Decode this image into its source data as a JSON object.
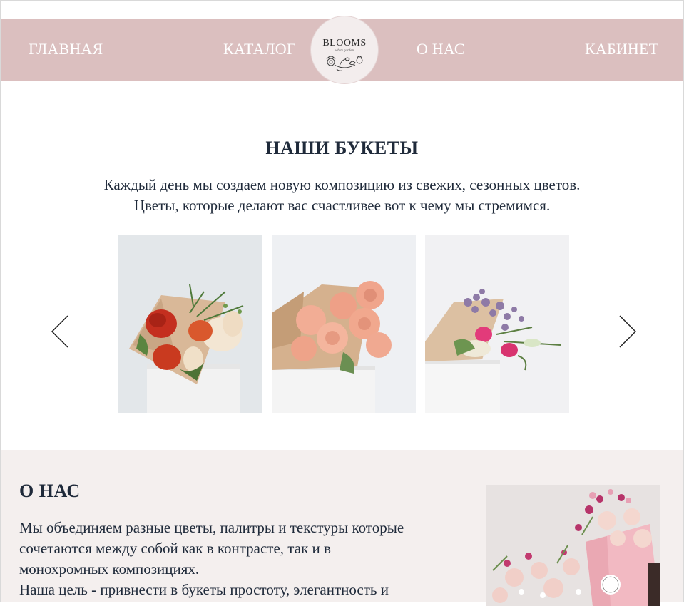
{
  "nav": {
    "home": "ГЛАВНАЯ",
    "catalog": "КАТАЛОГ",
    "about": "О НАС",
    "cabinet": "КАБИНЕТ",
    "logo_text": "BLOOMS",
    "logo_tagline": "white garden"
  },
  "bouquets": {
    "title": "НАШИ БУКЕТЫ",
    "intro_line1": "Каждый день мы создаем новую композицию из свежих, сезонных цветов.",
    "intro_line2": "Цветы, которые делают вас счастливее вот к чему мы стремимся."
  },
  "about": {
    "title": "О НАС",
    "lines": [
      "Мы объединяем разные цветы, палитры и текстуры которые",
      "сочетаются между собой как в контрасте, так и в",
      "монохромных композициях.",
      "Наша цель - привнести в букеты простоту, элегантность и"
    ]
  },
  "colors": {
    "nav_bg": "#dbbfbf",
    "about_bg": "#f4efee",
    "text": "#1f2a3a"
  }
}
